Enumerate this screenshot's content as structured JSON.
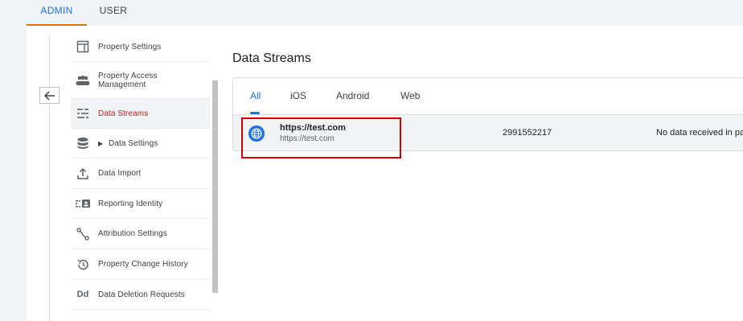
{
  "top_tabs": {
    "admin": "ADMIN",
    "user": "USER"
  },
  "sidebar": {
    "items": [
      {
        "label": "Property Settings",
        "icon": "property-settings-icon"
      },
      {
        "label": "Property Access Management",
        "icon": "people-icon"
      },
      {
        "label": "Data Streams",
        "icon": "data-streams-icon",
        "active": true
      },
      {
        "label": "Data Settings",
        "icon": "database-icon"
      },
      {
        "label": "Data Import",
        "icon": "upload-icon"
      },
      {
        "label": "Reporting Identity",
        "icon": "reporting-identity-icon"
      },
      {
        "label": "Attribution Settings",
        "icon": "attribution-icon"
      },
      {
        "label": "Property Change History",
        "icon": "history-icon"
      },
      {
        "label": "Data Deletion Requests",
        "icon": "data-deletion-icon",
        "icon_text": "Dd"
      }
    ]
  },
  "content": {
    "title": "Data Streams",
    "tabs": [
      "All",
      "iOS",
      "Android",
      "Web"
    ],
    "active_tab": "All",
    "streams": [
      {
        "name": "https://test.com",
        "url": "https://test.com",
        "id": "2991552217",
        "status": "No data received in pa"
      }
    ]
  },
  "colors": {
    "accent": "#1a73e8",
    "active_nav": "#c5221f",
    "highlight": "#d50000",
    "tab_underline": "#e8710a"
  }
}
